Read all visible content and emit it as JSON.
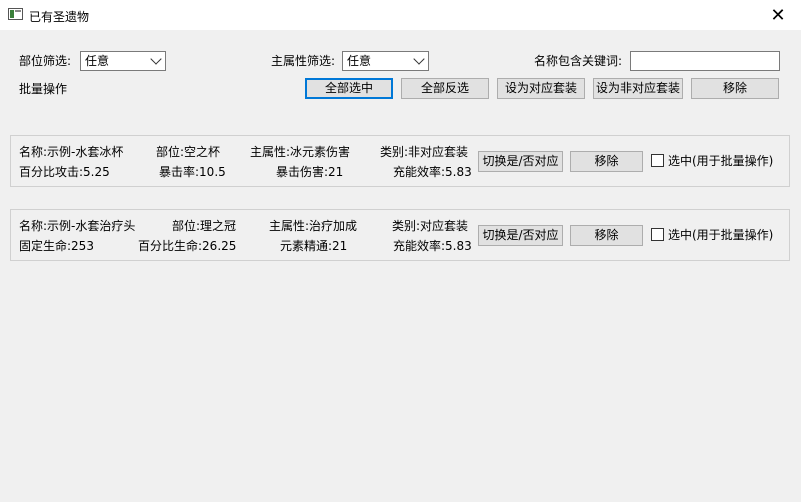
{
  "window": {
    "title": "已有圣遗物",
    "close_glyph": "✕"
  },
  "filters": {
    "slot_label": "部位筛选:",
    "slot_value": "任意",
    "main_stat_label": "主属性筛选:",
    "main_stat_value": "任意",
    "keyword_label": "名称包含关键词:",
    "keyword_value": ""
  },
  "batch": {
    "label": "批量操作",
    "select_all": "全部选中",
    "invert_select": "全部反选",
    "set_matching": "设为对应套装",
    "set_non_matching": "设为非对应套装",
    "remove": "移除"
  },
  "artifacts": [
    {
      "name": "名称:示例-水套冰杯",
      "slot": "部位:空之杯",
      "main_stat": "主属性:冰元素伤害",
      "category": "类别:非对应套装",
      "sub1": "百分比攻击:5.25",
      "sub2": "暴击率:10.5",
      "sub3": "暴击伤害:21",
      "sub4": "充能效率:5.83",
      "toggle_label": "切换是/否对应",
      "remove_label": "移除",
      "select_label": "选中(用于批量操作)",
      "selected": false
    },
    {
      "name": "名称:示例-水套治疗头",
      "slot": "部位:理之冠",
      "main_stat": "主属性:治疗加成",
      "category": "类别:对应套装",
      "sub1": "固定生命:253",
      "sub2": "百分比生命:26.25",
      "sub3": "元素精通:21",
      "sub4": "充能效率:5.83",
      "toggle_label": "切换是/否对应",
      "remove_label": "移除",
      "select_label": "选中(用于批量操作)",
      "selected": false
    }
  ]
}
